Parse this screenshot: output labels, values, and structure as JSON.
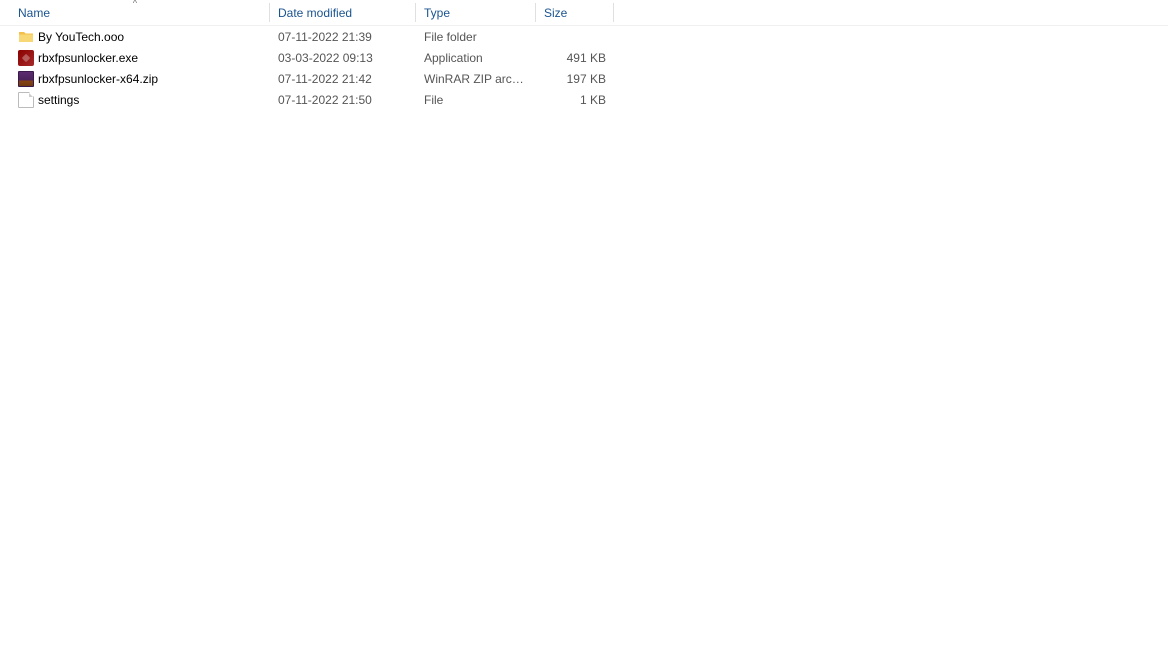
{
  "columns": {
    "name": "Name",
    "date": "Date modified",
    "type": "Type",
    "size": "Size"
  },
  "sort": {
    "column": "name",
    "direction": "asc"
  },
  "files": [
    {
      "icon": "folder",
      "name": "By YouTech.ooo",
      "date": "07-11-2022 21:39",
      "type": "File folder",
      "size": ""
    },
    {
      "icon": "exe",
      "name": "rbxfpsunlocker.exe",
      "date": "03-03-2022 09:13",
      "type": "Application",
      "size": "491 KB"
    },
    {
      "icon": "zip",
      "name": "rbxfpsunlocker-x64.zip",
      "date": "07-11-2022 21:42",
      "type": "WinRAR ZIP archive",
      "size": "197 KB"
    },
    {
      "icon": "file",
      "name": "settings",
      "date": "07-11-2022 21:50",
      "type": "File",
      "size": "1 KB"
    }
  ]
}
